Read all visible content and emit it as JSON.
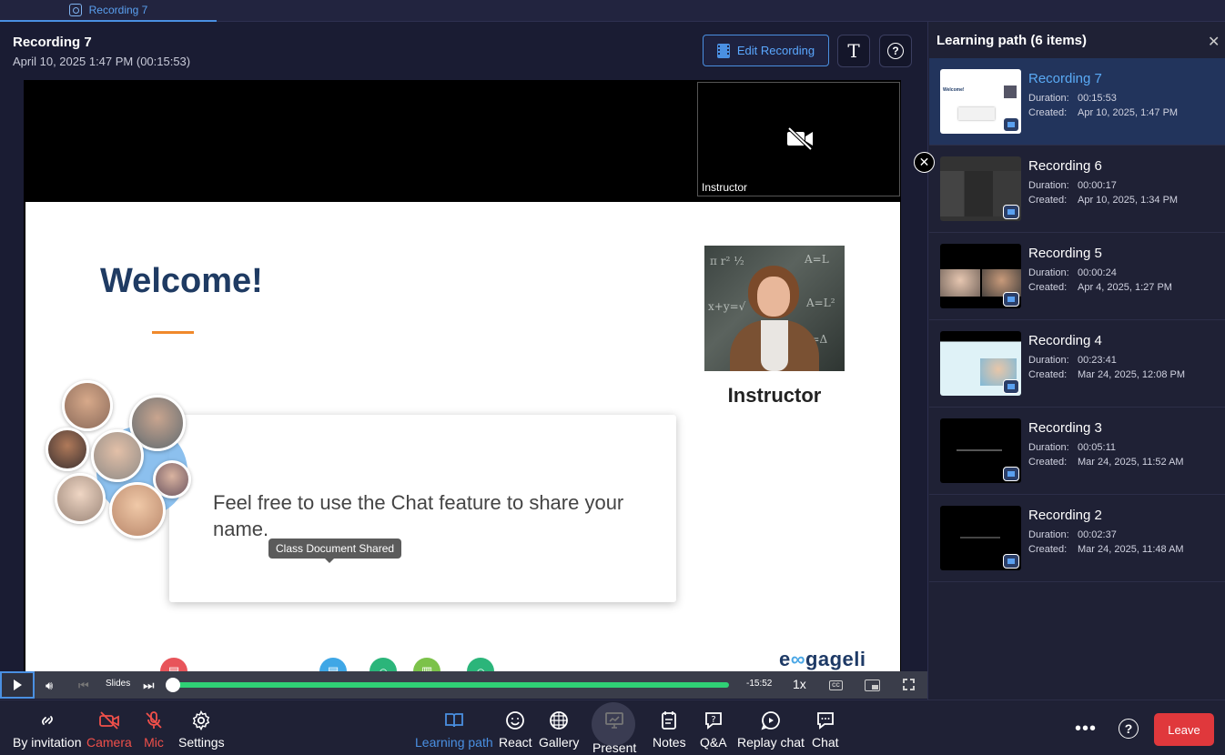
{
  "tabbar": {
    "tab_label": "Recording 7"
  },
  "header": {
    "title": "Recording 7",
    "subtitle": "April 10, 2025 1:47 PM (00:15:53)",
    "edit_label": "Edit Recording"
  },
  "video": {
    "camera_label": "Instructor",
    "slide_heading": "Welcome!",
    "photo_caption": "Instructor",
    "card_text": "Feel free to use the Chat feature to share your name.",
    "brand_pre": "e",
    "brand_mid": "∞",
    "brand_post": "gageli",
    "tooltip": "Class Document Shared"
  },
  "playback": {
    "slides_label": "Slides",
    "time_remaining": "-15:52",
    "speed": "1x",
    "cc_label": "CC",
    "progress": 0.0
  },
  "sidebar": {
    "title": "Learning path (6 items)",
    "duration_label": "Duration:",
    "created_label": "Created:",
    "items": [
      {
        "name": "Recording 7",
        "duration": "00:15:53",
        "created": "Apr 10, 2025, 1:47 PM",
        "active": true
      },
      {
        "name": "Recording 6",
        "duration": "00:00:17",
        "created": "Apr 10, 2025, 1:34 PM",
        "active": false
      },
      {
        "name": "Recording 5",
        "duration": "00:00:24",
        "created": "Apr 4, 2025, 1:27 PM",
        "active": false
      },
      {
        "name": "Recording 4",
        "duration": "00:23:41",
        "created": "Mar 24, 2025, 12:08 PM",
        "active": false
      },
      {
        "name": "Recording 3",
        "duration": "00:05:11",
        "created": "Mar 24, 2025, 11:52 AM",
        "active": false
      },
      {
        "name": "Recording 2",
        "duration": "00:02:37",
        "created": "Mar 24, 2025, 11:48 AM",
        "active": false
      }
    ]
  },
  "toolbar": {
    "by_invitation": "By invitation",
    "camera": "Camera",
    "mic": "Mic",
    "settings": "Settings",
    "learning_path": "Learning path",
    "react": "React",
    "gallery": "Gallery",
    "present": "Present",
    "notes": "Notes",
    "qa": "Q&A",
    "replay_chat": "Replay chat",
    "chat": "Chat",
    "leave": "Leave"
  },
  "colors": {
    "accent": "#4a90e2",
    "danger": "#e0383c",
    "progress": "#2fd075"
  }
}
